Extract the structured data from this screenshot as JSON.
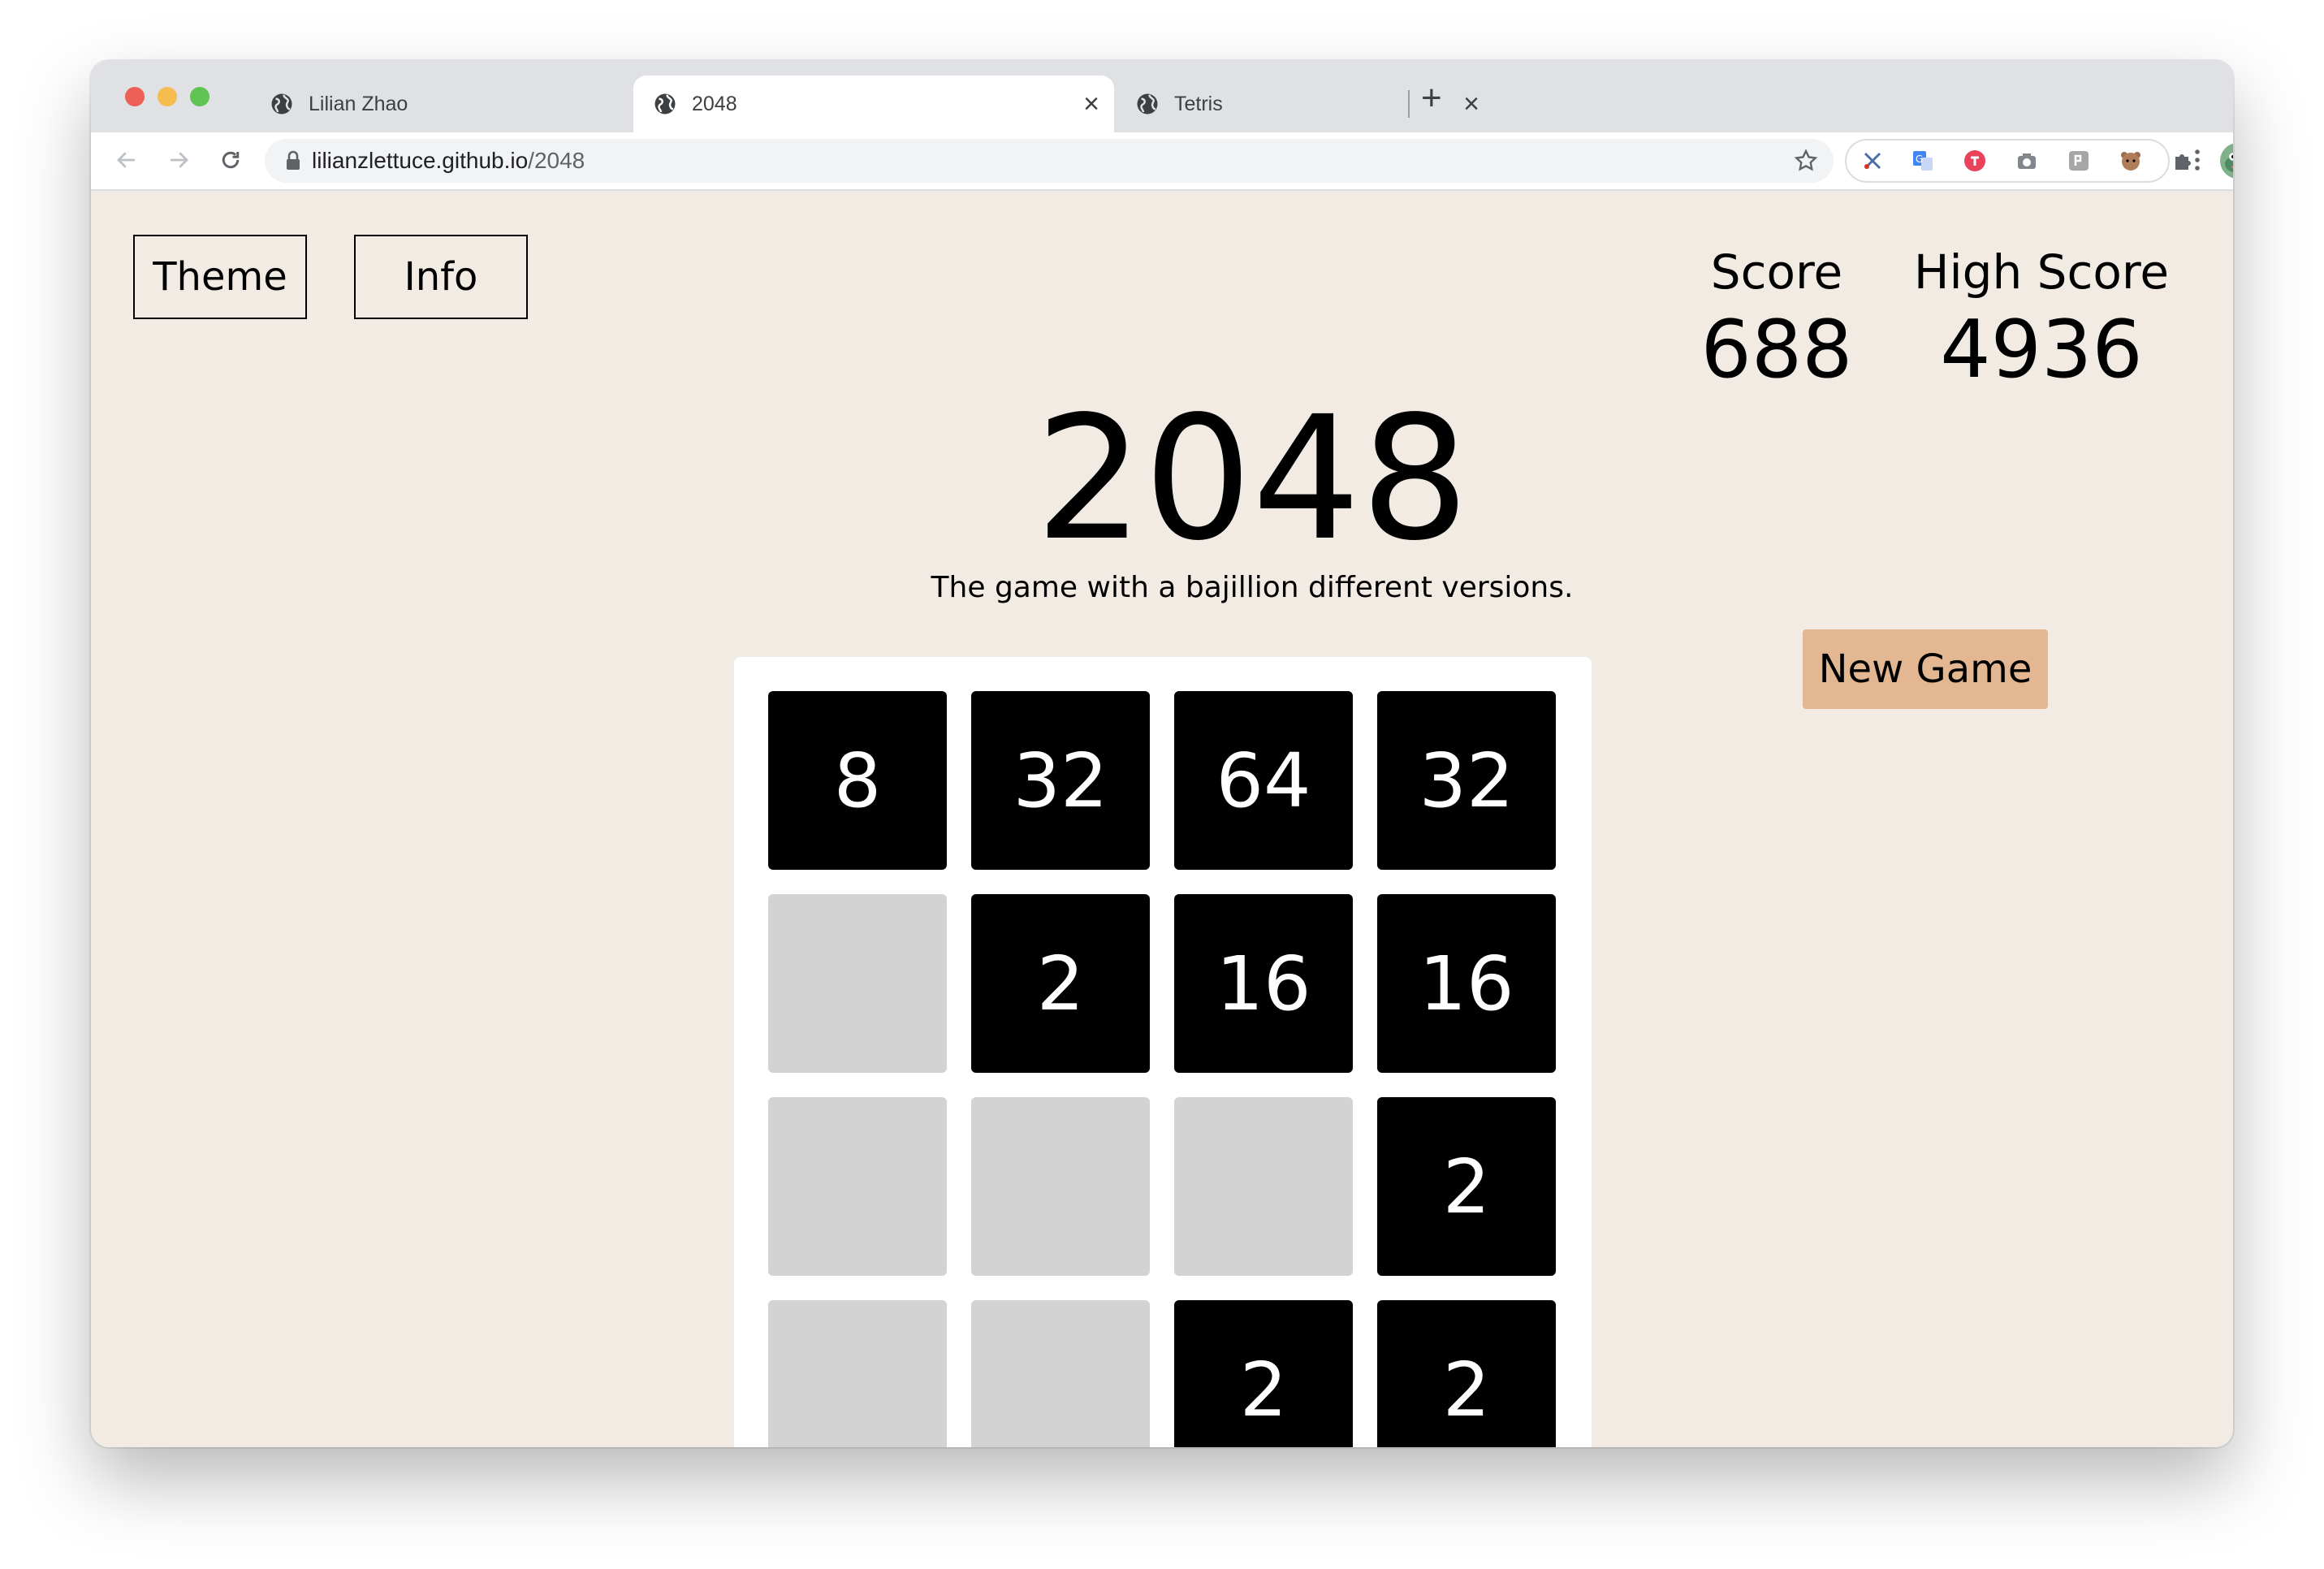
{
  "browser": {
    "tabs": [
      {
        "title": "Lilian Zhao",
        "active": false
      },
      {
        "title": "2048",
        "active": true
      },
      {
        "title": "Tetris",
        "active": false
      }
    ],
    "url_host": "lilianzlettuce.github.io",
    "url_path": "/2048"
  },
  "header": {
    "theme_label": "Theme",
    "info_label": "Info"
  },
  "scores": {
    "score_label": "Score",
    "score_value": "688",
    "high_label": "High Score",
    "high_value": "4936"
  },
  "game": {
    "title": "2048",
    "subtitle": "The game with a bajillion different versions.",
    "new_game_label": "New Game",
    "grid": [
      [
        "8",
        "32",
        "64",
        "32"
      ],
      [
        "",
        "2",
        "16",
        "16"
      ],
      [
        "",
        "",
        "",
        "2"
      ],
      [
        "",
        "",
        "2",
        "2"
      ]
    ]
  },
  "colors": {
    "page_bg": "#f2ebe4",
    "tile_filled": "#000000",
    "tile_empty": "#d3d3d3",
    "new_game_bg": "#e2b792"
  }
}
